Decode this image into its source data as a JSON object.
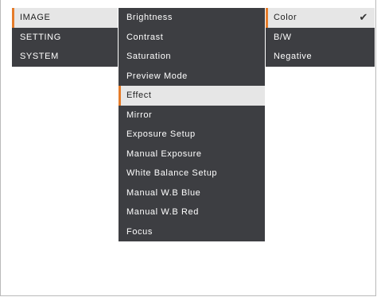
{
  "main_menu": {
    "items": [
      "IMAGE",
      "SETTING",
      "SYSTEM"
    ],
    "selected_index": 0
  },
  "image_menu": {
    "items": [
      "Brightness",
      "Contrast",
      "Saturation",
      "Preview Mode",
      "Effect",
      "Mirror",
      "Exposure Setup",
      "Manual Exposure",
      "White Balance Setup",
      "Manual W.B Blue",
      "Manual W.B Red",
      "Focus"
    ],
    "selected_index": 4
  },
  "effect_options": {
    "items": [
      "Color",
      "B/W",
      "Negative"
    ],
    "selected_index": 0,
    "checked_icon": "checkmark-icon"
  },
  "colors": {
    "menu_background": "#3d3e42",
    "selected_background": "#e6e6e6",
    "accent": "#e57c2a"
  }
}
